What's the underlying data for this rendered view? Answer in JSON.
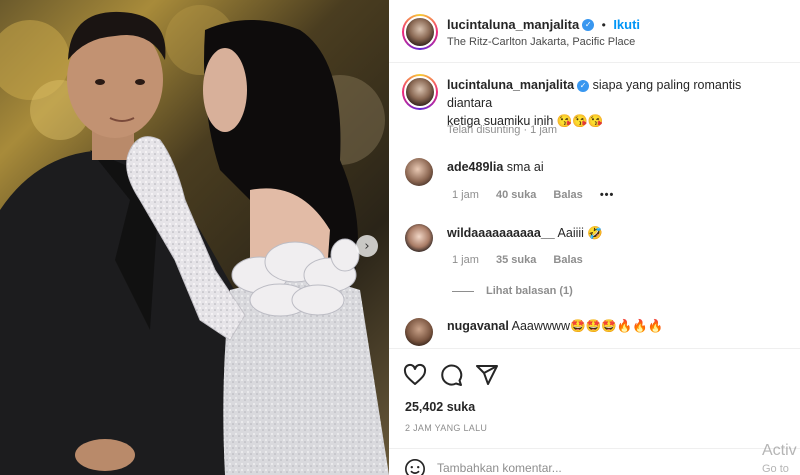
{
  "post": {
    "username": "lucintaluna_manjalita",
    "follow_label": "Ikuti",
    "location": "The Ritz-Carlton Jakarta, Pacific Place",
    "caption_line1": "siapa yang paling romantis diantara",
    "caption_line2": "ketiga suamiku inih 😘😘😘",
    "caption_meta": "Telah disunting · 1 jam"
  },
  "comments": [
    {
      "username": "ade489lia",
      "text": "sma ai",
      "time": "1 jam",
      "likes": "40 suka",
      "reply": "Balas",
      "more": "•••"
    },
    {
      "username": "wildaaaaaaaaaa__",
      "text": "Aaiiii 🤣",
      "time": "1 jam",
      "likes": "35 suka",
      "reply": "Balas",
      "view_replies": "Lihat balasan (1)"
    },
    {
      "username": "nugavanal",
      "text": "Aaawwww🤩🤩🤩🔥🔥🔥"
    }
  ],
  "footer": {
    "likes": "25,402 suka",
    "time_ago": "2 JAM YANG LALU",
    "comment_placeholder": "Tambahkan komentar..."
  },
  "carousel": {
    "next_glyph": "›"
  },
  "watermark": {
    "line1": "Activ",
    "line2": "Go to"
  },
  "colors": {
    "accent": "#0095f6",
    "verified": "#3897f0",
    "muted": "#8e8e8e"
  }
}
